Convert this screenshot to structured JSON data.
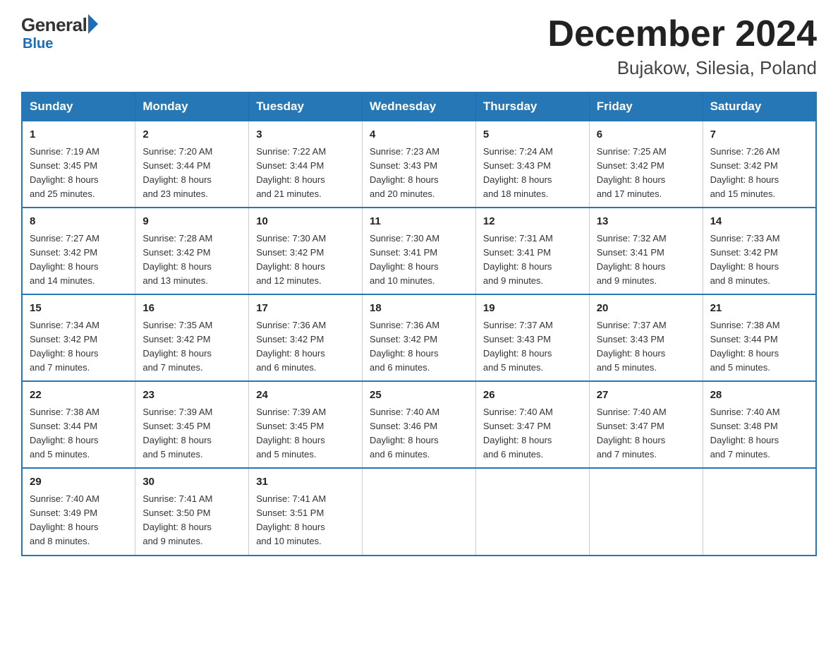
{
  "logo": {
    "general": "General",
    "blue": "Blue"
  },
  "header": {
    "title": "December 2024",
    "subtitle": "Bujakow, Silesia, Poland"
  },
  "weekdays": [
    "Sunday",
    "Monday",
    "Tuesday",
    "Wednesday",
    "Thursday",
    "Friday",
    "Saturday"
  ],
  "weeks": [
    [
      {
        "day": "1",
        "sunrise": "7:19 AM",
        "sunset": "3:45 PM",
        "daylight": "8 hours and 25 minutes."
      },
      {
        "day": "2",
        "sunrise": "7:20 AM",
        "sunset": "3:44 PM",
        "daylight": "8 hours and 23 minutes."
      },
      {
        "day": "3",
        "sunrise": "7:22 AM",
        "sunset": "3:44 PM",
        "daylight": "8 hours and 21 minutes."
      },
      {
        "day": "4",
        "sunrise": "7:23 AM",
        "sunset": "3:43 PM",
        "daylight": "8 hours and 20 minutes."
      },
      {
        "day": "5",
        "sunrise": "7:24 AM",
        "sunset": "3:43 PM",
        "daylight": "8 hours and 18 minutes."
      },
      {
        "day": "6",
        "sunrise": "7:25 AM",
        "sunset": "3:42 PM",
        "daylight": "8 hours and 17 minutes."
      },
      {
        "day": "7",
        "sunrise": "7:26 AM",
        "sunset": "3:42 PM",
        "daylight": "8 hours and 15 minutes."
      }
    ],
    [
      {
        "day": "8",
        "sunrise": "7:27 AM",
        "sunset": "3:42 PM",
        "daylight": "8 hours and 14 minutes."
      },
      {
        "day": "9",
        "sunrise": "7:28 AM",
        "sunset": "3:42 PM",
        "daylight": "8 hours and 13 minutes."
      },
      {
        "day": "10",
        "sunrise": "7:30 AM",
        "sunset": "3:42 PM",
        "daylight": "8 hours and 12 minutes."
      },
      {
        "day": "11",
        "sunrise": "7:30 AM",
        "sunset": "3:41 PM",
        "daylight": "8 hours and 10 minutes."
      },
      {
        "day": "12",
        "sunrise": "7:31 AM",
        "sunset": "3:41 PM",
        "daylight": "8 hours and 9 minutes."
      },
      {
        "day": "13",
        "sunrise": "7:32 AM",
        "sunset": "3:41 PM",
        "daylight": "8 hours and 9 minutes."
      },
      {
        "day": "14",
        "sunrise": "7:33 AM",
        "sunset": "3:42 PM",
        "daylight": "8 hours and 8 minutes."
      }
    ],
    [
      {
        "day": "15",
        "sunrise": "7:34 AM",
        "sunset": "3:42 PM",
        "daylight": "8 hours and 7 minutes."
      },
      {
        "day": "16",
        "sunrise": "7:35 AM",
        "sunset": "3:42 PM",
        "daylight": "8 hours and 7 minutes."
      },
      {
        "day": "17",
        "sunrise": "7:36 AM",
        "sunset": "3:42 PM",
        "daylight": "8 hours and 6 minutes."
      },
      {
        "day": "18",
        "sunrise": "7:36 AM",
        "sunset": "3:42 PM",
        "daylight": "8 hours and 6 minutes."
      },
      {
        "day": "19",
        "sunrise": "7:37 AM",
        "sunset": "3:43 PM",
        "daylight": "8 hours and 5 minutes."
      },
      {
        "day": "20",
        "sunrise": "7:37 AM",
        "sunset": "3:43 PM",
        "daylight": "8 hours and 5 minutes."
      },
      {
        "day": "21",
        "sunrise": "7:38 AM",
        "sunset": "3:44 PM",
        "daylight": "8 hours and 5 minutes."
      }
    ],
    [
      {
        "day": "22",
        "sunrise": "7:38 AM",
        "sunset": "3:44 PM",
        "daylight": "8 hours and 5 minutes."
      },
      {
        "day": "23",
        "sunrise": "7:39 AM",
        "sunset": "3:45 PM",
        "daylight": "8 hours and 5 minutes."
      },
      {
        "day": "24",
        "sunrise": "7:39 AM",
        "sunset": "3:45 PM",
        "daylight": "8 hours and 5 minutes."
      },
      {
        "day": "25",
        "sunrise": "7:40 AM",
        "sunset": "3:46 PM",
        "daylight": "8 hours and 6 minutes."
      },
      {
        "day": "26",
        "sunrise": "7:40 AM",
        "sunset": "3:47 PM",
        "daylight": "8 hours and 6 minutes."
      },
      {
        "day": "27",
        "sunrise": "7:40 AM",
        "sunset": "3:47 PM",
        "daylight": "8 hours and 7 minutes."
      },
      {
        "day": "28",
        "sunrise": "7:40 AM",
        "sunset": "3:48 PM",
        "daylight": "8 hours and 7 minutes."
      }
    ],
    [
      {
        "day": "29",
        "sunrise": "7:40 AM",
        "sunset": "3:49 PM",
        "daylight": "8 hours and 8 minutes."
      },
      {
        "day": "30",
        "sunrise": "7:41 AM",
        "sunset": "3:50 PM",
        "daylight": "8 hours and 9 minutes."
      },
      {
        "day": "31",
        "sunrise": "7:41 AM",
        "sunset": "3:51 PM",
        "daylight": "8 hours and 10 minutes."
      },
      null,
      null,
      null,
      null
    ]
  ],
  "labels": {
    "sunrise": "Sunrise:",
    "sunset": "Sunset:",
    "daylight": "Daylight:"
  }
}
